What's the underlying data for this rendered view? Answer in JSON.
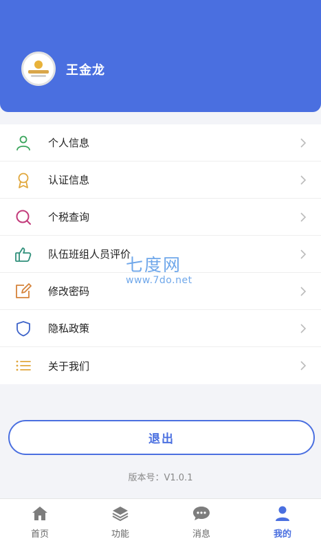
{
  "profile": {
    "name": "王金龙"
  },
  "menu": [
    {
      "label": "个人信息",
      "icon": "user-icon",
      "color": "#3aa55c"
    },
    {
      "label": "认证信息",
      "icon": "badge-icon",
      "color": "#e0a63a"
    },
    {
      "label": "个税查询",
      "icon": "search-icon",
      "color": "#c23a7a"
    },
    {
      "label": "队伍班组人员评价",
      "icon": "thumbs-up-icon",
      "color": "#2f8f7a"
    },
    {
      "label": "修改密码",
      "icon": "edit-icon",
      "color": "#d5833a"
    },
    {
      "label": "隐私政策",
      "icon": "shield-icon",
      "color": "#3d63c9"
    },
    {
      "label": "关于我们",
      "icon": "list-icon",
      "color": "#e0a63a"
    }
  ],
  "watermark": {
    "top": "七度网",
    "bottom": "www.7do.net"
  },
  "logout_label": "退出",
  "version": "版本号：V1.0.1",
  "tabs": [
    {
      "label": "首页",
      "icon": "home-icon"
    },
    {
      "label": "功能",
      "icon": "layers-icon"
    },
    {
      "label": "消息",
      "icon": "chat-icon"
    },
    {
      "label": "我的",
      "icon": "person-icon",
      "active": true
    }
  ],
  "colors": {
    "primary": "#4a6fe0",
    "background": "#f3f4f8"
  }
}
